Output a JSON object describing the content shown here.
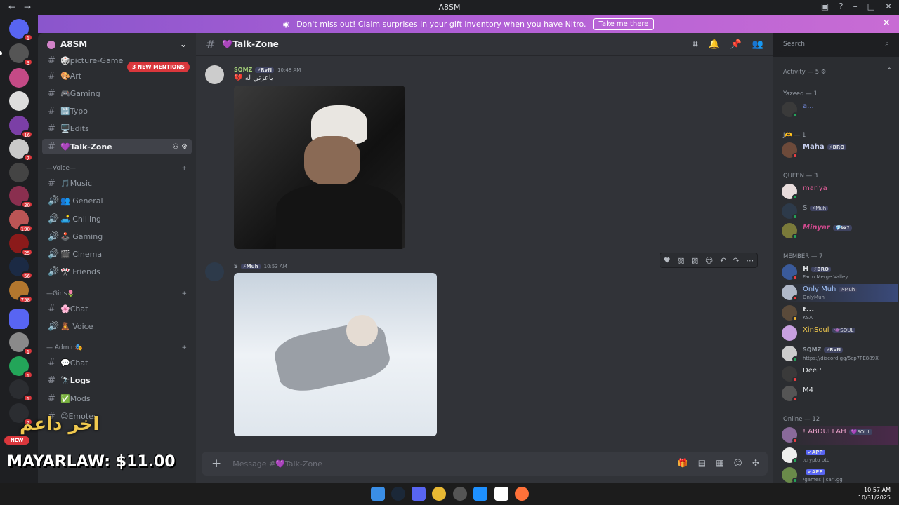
{
  "window": {
    "title": "A8SM"
  },
  "nitro_banner": {
    "text": "Don't miss out! Claim surprises in your gift inventory when you have Nitro.",
    "button": "Take me there"
  },
  "server": {
    "name": "A8SM",
    "mentions_pill": "3 NEW MENTIONS"
  },
  "guild_badges": [
    "1",
    "3",
    "16",
    "7",
    "30",
    "190",
    "25",
    "56",
    "758",
    "1",
    "1",
    "1",
    "2"
  ],
  "channels": [
    {
      "name": "🎲picture-Game"
    },
    {
      "name": "🎨Art"
    },
    {
      "name": "🎮Gaming"
    },
    {
      "name": "🔡Typo"
    },
    {
      "name": "🖥️Edits"
    },
    {
      "name": "💜Talk-Zone"
    },
    {
      "category": "—Voice—"
    },
    {
      "name": "🎵Music"
    },
    {
      "name": "👥 General"
    },
    {
      "name": "🛋️ Chilling"
    },
    {
      "name": "🕹️ Gaming"
    },
    {
      "name": "🎬 Cinema"
    },
    {
      "name": "🎌 Friends"
    },
    {
      "category": "—Girls🌷"
    },
    {
      "name": "🌸Chat"
    },
    {
      "name": "🧸 Voice"
    },
    {
      "category": "— Admin🎭"
    },
    {
      "name": "💬Chat"
    },
    {
      "name": "🔭Logs"
    },
    {
      "name": "✅Mods"
    },
    {
      "name": "😊Emotes"
    }
  ],
  "chat": {
    "channel_name": "💜Talk-Zone",
    "messages": [
      {
        "author": "SQMZ",
        "tag": "⚡RvN",
        "time": "10:48 AM",
        "text": "💔 ياعزتي له"
      },
      {
        "author": "S",
        "tag": "⚡Muh",
        "time": "10:53 AM",
        "text": ""
      }
    ],
    "composer_placeholder": "Message #💜Talk-Zone"
  },
  "search": {
    "placeholder": "Search"
  },
  "members": {
    "groups": [
      {
        "label": "Activity — 5 ⚙"
      },
      {
        "label": "Yazeed — 1"
      },
      {
        "label": "J🫶 — 1"
      },
      {
        "label": "QUEEN — 3"
      },
      {
        "label": "MEMBER — 7"
      },
      {
        "label": "Online — 12"
      }
    ],
    "list": [
      {
        "name": "a...",
        "sub": ""
      },
      {
        "name": "Maha",
        "tag": "⚡BRQ",
        "sub": ""
      },
      {
        "name": "mariya",
        "sub": ""
      },
      {
        "name": "S",
        "tag": "⚡Muh",
        "sub": ""
      },
      {
        "name": "Minyar",
        "tag": "💎W1",
        "sub": ""
      },
      {
        "name": "H",
        "tag": "⚡BRQ",
        "sub": "Farm Merge Valley"
      },
      {
        "name": "Only Muh",
        "tag": "⚡Muh",
        "sub": "OnlyMuh"
      },
      {
        "name": "t...",
        "sub": "KSA"
      },
      {
        "name": "XinSoul",
        "tag": "👾SOUL",
        "sub": ""
      },
      {
        "name": "SQMZ",
        "tag": "⚡RvN",
        "sub": "https://discord.gg/5cp7PE889X"
      },
      {
        "name": "DeeP",
        "sub": ""
      },
      {
        "name": "M4",
        "sub": ""
      },
      {
        "name": "! ABDULLAH",
        "tag": "💜SOUL",
        "sub": ""
      },
      {
        "name": "",
        "tag": "✔APP",
        "sub": ".crypto btc"
      },
      {
        "name": "",
        "tag": "✔APP",
        "sub": "/games | carl.gg"
      }
    ]
  },
  "overlay": {
    "arabic": "اخر داعم",
    "price": "MAYARLAW: $11.00",
    "new": "NEW"
  },
  "clock": {
    "time": "10:57 AM",
    "date": "10/31/2025"
  },
  "colors": {
    "accent": "#5865f2",
    "danger": "#da373c",
    "username_green": "#a6d27a"
  }
}
